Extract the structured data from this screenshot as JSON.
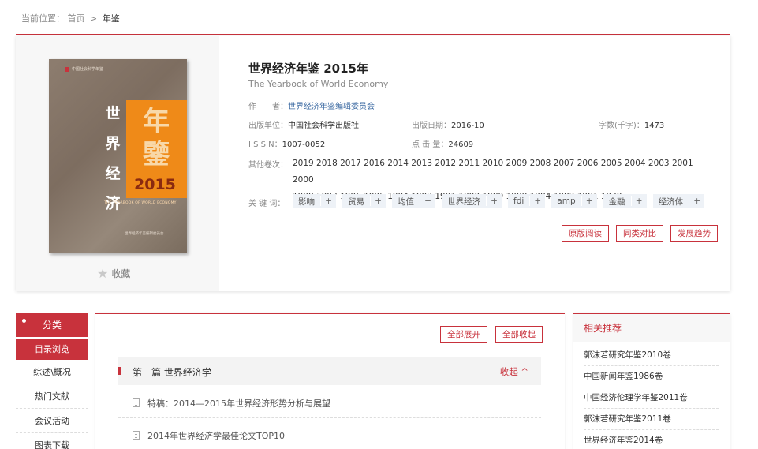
{
  "breadcrumb": {
    "prefix": "当前位置：",
    "home": "首页",
    "sep": ">",
    "current": "年鉴"
  },
  "cover": {
    "publisher_logo": "中国社会科学年鉴",
    "vertical_title": [
      "世",
      "界",
      "经",
      "济"
    ],
    "big_chars": "年鑒",
    "year": "2015",
    "english": "THE YEARBOOK OF WORLD ECONOMY",
    "publisher_bottom": "世界经济年鉴编辑委员会"
  },
  "favorite_label": "收藏",
  "book": {
    "title": "世界经济年鉴 2015年",
    "subtitle": "The Yearbook of World Economy",
    "author_label": "作　　者：",
    "author": "世界经济年鉴编辑委员会",
    "publisher_label": "出版单位：",
    "publisher": "中国社会科学出版社",
    "date_label": "出版日期：",
    "date": "2016-10",
    "words_label": "字数(千字)：",
    "words": "1473",
    "issn_label": "I S S N：",
    "issn": "1007-0052",
    "clicks_label": "点 击 量：",
    "clicks": "24609",
    "volumes_label": "其他卷次：",
    "volumes_line1": "2019 2018 2017 2016 2014 2013 2012 2011 2010 2009 2008 2007 2006 2005 2004 2003 2001 2000",
    "volumes_line2": "1998 1997 1996 1995 1994 1992 1991 1990 1989 1988 1984 1982 1981 1979",
    "keywords_label": "关 键 词：",
    "keywords": [
      "影响",
      "贸易",
      "均值",
      "世界经济",
      "fdi",
      "amp",
      "金融",
      "经济体"
    ],
    "keyword_plus": "+",
    "actions": [
      "原版阅读",
      "同类对比",
      "发展趋势"
    ]
  },
  "leftmenu": {
    "category": "分类",
    "items": [
      "目录浏览",
      "综述\\概况",
      "热门文献",
      "会议活动",
      "图表下载"
    ]
  },
  "main": {
    "expand_all": "全部展开",
    "collapse_all": "全部收起",
    "chapter_title": "第一篇 世界经济学",
    "chapter_toggle": "收起 ^",
    "articles": [
      "特稿：2014—2015年世界经济形势分析与展望",
      "2014年世界经济学最佳论文TOP10"
    ]
  },
  "recommend": {
    "title": "相关推荐",
    "items": [
      "郭沫若研究年鉴2010卷",
      "中国新闻年鉴1986卷",
      "中国经济伦理学年鉴2011卷",
      "郭沫若研究年鉴2011卷",
      "世界经济年鉴2014卷"
    ]
  }
}
